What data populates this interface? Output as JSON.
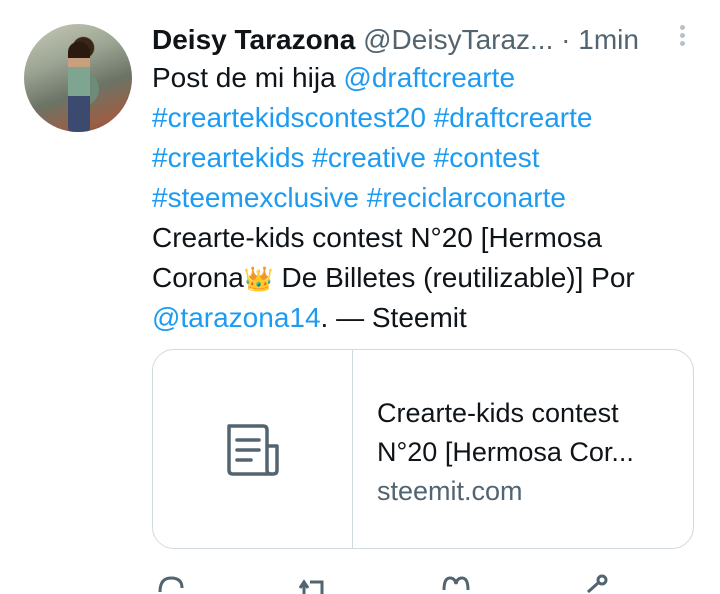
{
  "tweet": {
    "author_name": "Deisy Tarazona",
    "author_handle": "@DeisyTaraz...",
    "separator": "·",
    "time": "1min",
    "lines": [
      {
        "text": "Post de mi hija ",
        "mention": "@draftcrearte"
      },
      {
        "tags": "#creartekidscontest20 #draftcrearte"
      },
      {
        "tags": "#creartekids #creative  #contest"
      },
      {
        "tags": "#steemexclusive #reciclarconarte"
      },
      {
        "text": "Crearte-kids contest N°20 [Hermosa"
      },
      {
        "text_before": "Corona",
        "emoji": "👑",
        "text_after": " De Billetes (reutilizable)] Por"
      },
      {
        "mention": "@tarazona14",
        "text_after": ". — Steemit"
      }
    ]
  },
  "card": {
    "title_line1": "Crearte-kids contest",
    "title_line2": "N°20 [Hermosa Cor...",
    "domain": "steemit.com",
    "thumb_icon": "document-icon"
  },
  "actions": [
    "reply-icon",
    "retweet-icon",
    "like-icon",
    "share-icon"
  ],
  "colors": {
    "link": "#1d9bf0",
    "text": "#0f1419",
    "muted": "#536471",
    "border": "#cfd9de"
  }
}
